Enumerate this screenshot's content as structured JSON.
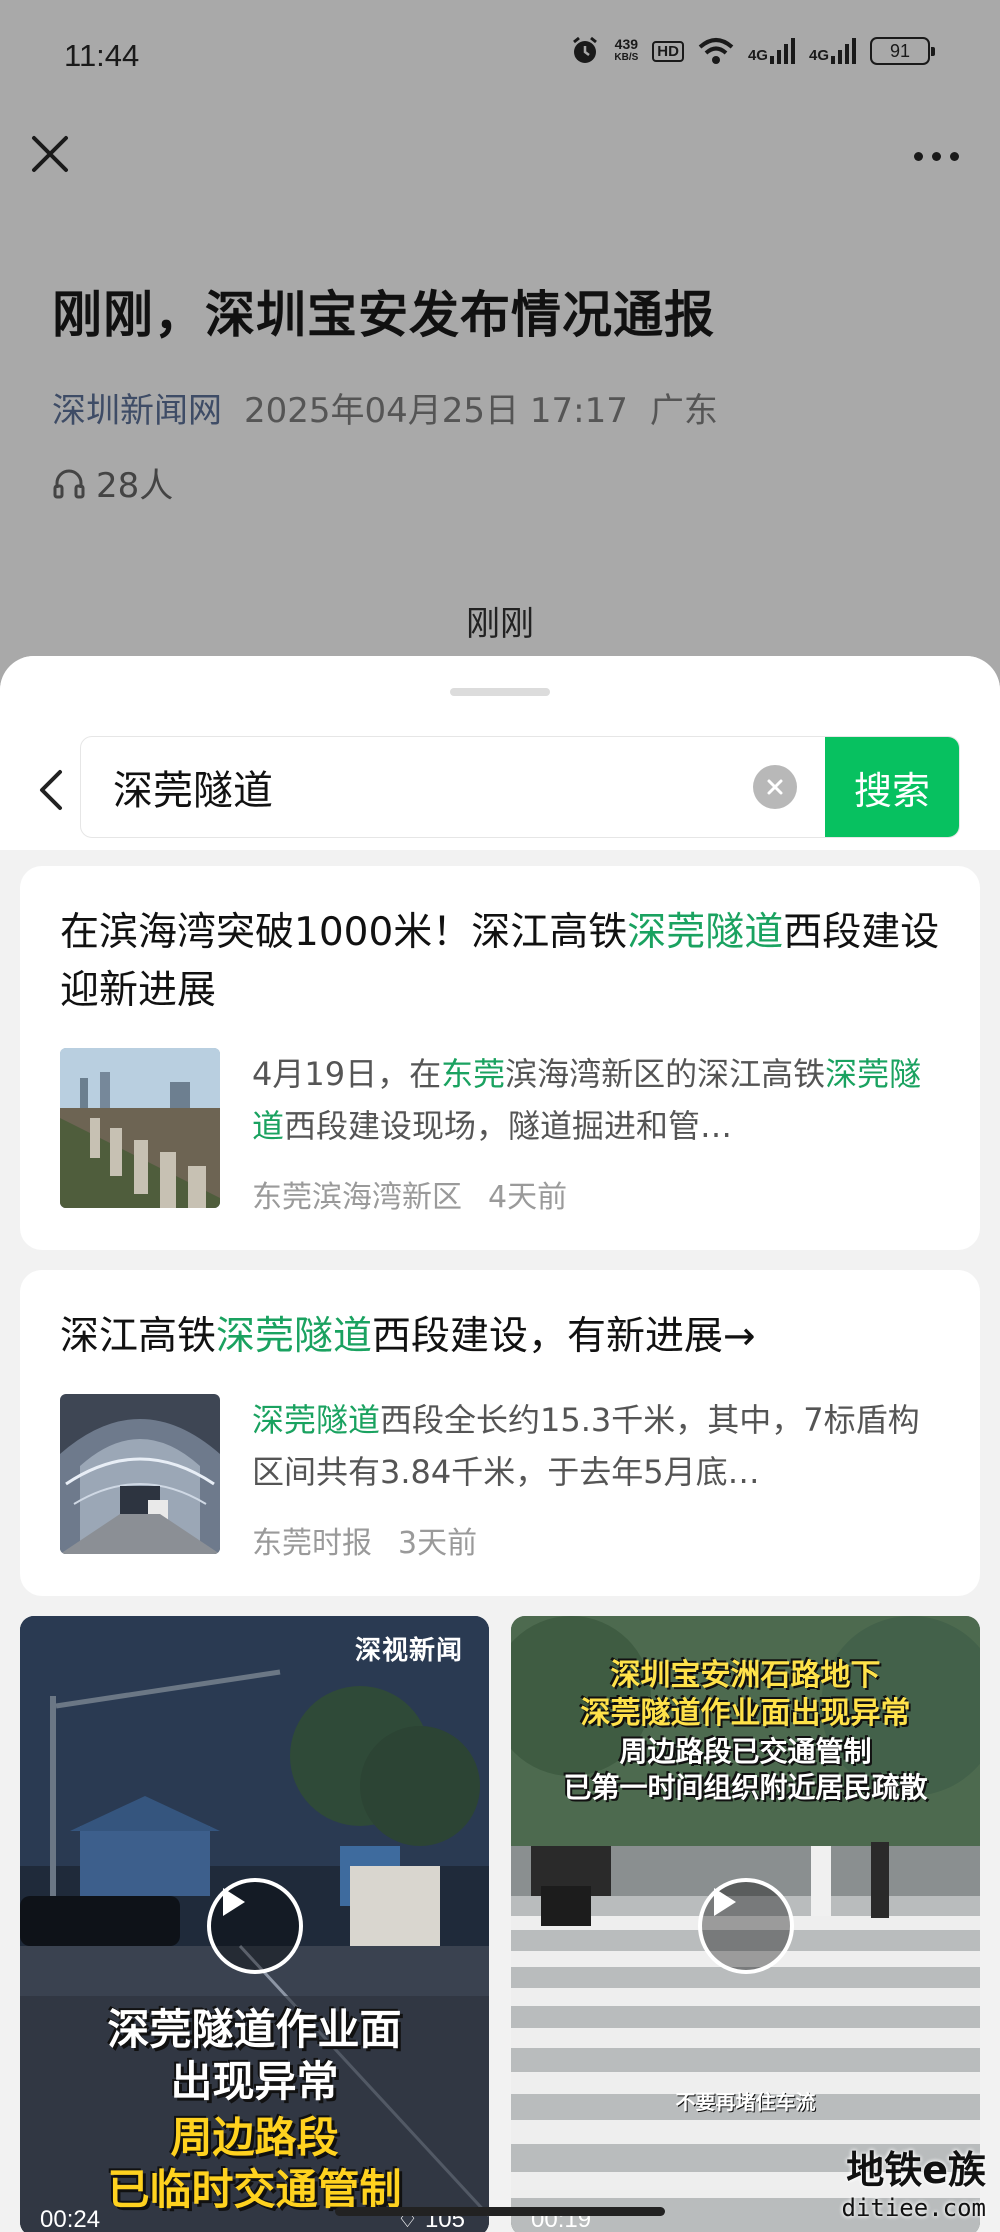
{
  "status_bar": {
    "time": "11:44",
    "net_speed": "439",
    "net_unit": "KB/S",
    "hd": "HD",
    "signal1": "4G",
    "signal2": "4G",
    "battery": "91"
  },
  "article": {
    "title": "刚刚，深圳宝安发布情况通报",
    "source": "深圳新闻网",
    "date": "2025年04月25日 17:17",
    "region": "广东",
    "listeners": "28人",
    "intro": "刚刚"
  },
  "search": {
    "query": "深莞隧道",
    "button_label": "搜索"
  },
  "results": [
    {
      "title_pre": "在滨海湾突破1000米！深江高铁",
      "title_hl": "深莞隧道",
      "title_post": "西段建设迎新进展",
      "snippet_pre": "4月19日，在",
      "snippet_hl1": "东莞",
      "snippet_mid": "滨海湾新区的深江高铁",
      "snippet_hl2": "深莞隧道",
      "snippet_post": "西段建设现场，隧道掘进和管…",
      "publisher": "东莞滨海湾新区",
      "time": "4天前"
    },
    {
      "title_pre": "深江高铁",
      "title_hl": "深莞隧道",
      "title_post": "西段建设，有新进展→",
      "snippet_hl": "深莞隧道",
      "snippet_post": "西段全长约15.3千米，其中，7标盾构区间共有3.84千米，于去年5月底…",
      "publisher": "东莞时报",
      "time": "3天前"
    }
  ],
  "videos": [
    {
      "logo": "深视新闻",
      "line1": "深莞隧道作业面",
      "line2": "出现异常",
      "line3": "周边路段",
      "line4": "已临时交通管制",
      "duration": "00:24",
      "likes": "♢ 105"
    },
    {
      "line1": "深圳宝安洲石路地下",
      "line2": "深莞隧道作业面出现异常",
      "line3": "周边路段已交通管制",
      "line4": "已第一时间组织附近居民疏散",
      "caption": "不要再堵住车流",
      "duration": "00:19"
    }
  ],
  "watermark": {
    "line1": "地铁e族",
    "line2": "ditiee.com"
  },
  "colors": {
    "accent": "#07c160",
    "highlight": "#1aa260"
  }
}
